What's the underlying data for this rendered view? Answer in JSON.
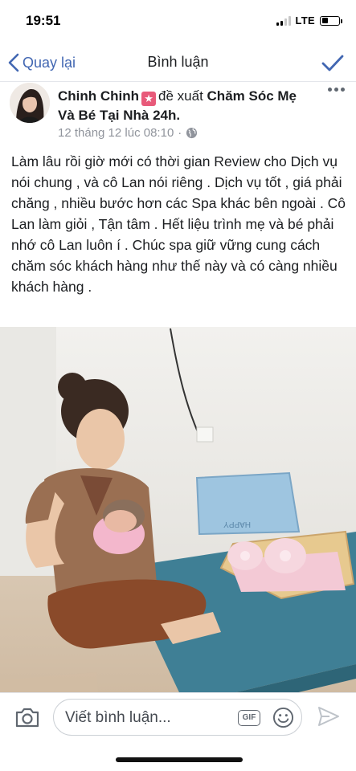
{
  "status_bar": {
    "time": "19:51",
    "network": "LTE",
    "signal_bars": 2,
    "battery_level": 0.35
  },
  "nav": {
    "back_label": "Quay lại",
    "title": "Bình luận",
    "back_icon": "chevron-left-icon",
    "confirm_icon": "checkmark-icon",
    "accent_color": "#4267b2"
  },
  "post": {
    "author": "Chinh Chinh",
    "badge_icon": "recommend-star-icon",
    "action": "đề xuất",
    "page_name": "Chăm Sóc Mẹ Và Bé Tại Nhà 24h.",
    "timestamp": "12 tháng 12 lúc 08:10",
    "separator": "·",
    "privacy_icon": "globe-icon",
    "more_icon": "more-options-icon",
    "body": "Làm lâu rồi giờ mới có thời gian Review cho Dịch vụ nói chung , và cô Lan nói riêng . Dịch vụ tốt , giá phải chăng , nhiều bước hơn các Spa khác bên ngoài . Cô Lan làm giỏi , Tận tâm . Hết liệu trình mẹ và bé phải nhớ cô Lan luôn í . Chúc spa giữ vững cung cách chăm sóc khách hàng như thế này và có càng nhiều khách hàng ."
  },
  "photo": {
    "pillow_text": "HAPPY"
  },
  "comment_bar": {
    "placeholder": "Viết bình luận...",
    "gif_label": "GIF",
    "camera_icon": "camera-icon",
    "emoji_icon": "emoji-icon",
    "send_icon": "send-icon"
  }
}
